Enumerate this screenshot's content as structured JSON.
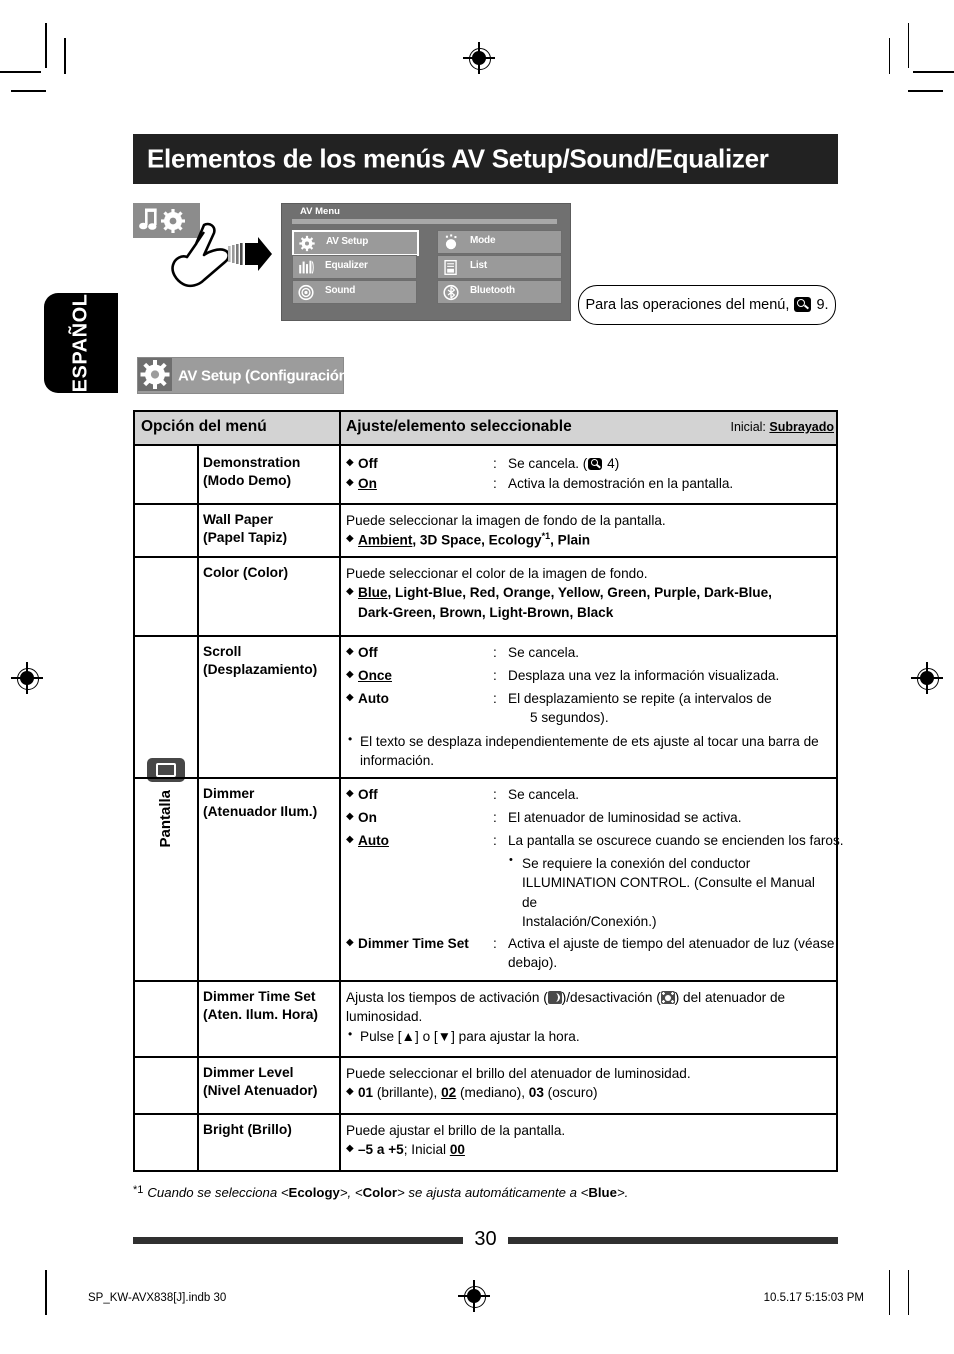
{
  "page": {
    "title": "Elementos de los menús AV Setup/Sound/Equalizer",
    "language_tab": "ESPAÑOL",
    "page_number": "30",
    "print_left": "SP_KW-AVX838[J].indb   30",
    "print_right": "10.5.17   5:15:03 PM"
  },
  "device_screen": {
    "header": "AV Menu",
    "buttons": [
      {
        "label": "AV Setup",
        "icon": "gear-icon",
        "selected": true
      },
      {
        "label": "Mode",
        "icon": "mode-icon",
        "selected": false
      },
      {
        "label": "Equalizer",
        "icon": "equalizer-icon",
        "selected": false
      },
      {
        "label": "List",
        "icon": "list-icon",
        "selected": false
      },
      {
        "label": "Sound",
        "icon": "sound-icon",
        "selected": false
      },
      {
        "label": "Bluetooth",
        "icon": "bluetooth-icon",
        "selected": false
      }
    ]
  },
  "callout": {
    "text_before": "Para las operaciones del menú,",
    "page_ref": "9."
  },
  "section": {
    "badge_label": "AV Setup (Configuración AV)",
    "side_tab_label": "Pantalla"
  },
  "table": {
    "header": {
      "col1": "Opción del menú",
      "col2": "Ajuste/elemento seleccionable",
      "initial_prefix": "Inicial:",
      "initial_value": "Subrayado"
    },
    "rows": {
      "demonstration": {
        "name_en": "Demonstration",
        "name_es": "(Modo Demo)",
        "options": [
          {
            "value": "Off",
            "underlined": false,
            "desc_before": "Se cancela. (",
            "ref": "4",
            "desc_after": ")"
          },
          {
            "value": "On",
            "underlined": true,
            "desc": "Activa la demostración en la pantalla."
          }
        ]
      },
      "wall_paper": {
        "name_en": "Wall Paper",
        "name_es": "(Papel Tapiz)",
        "intro": "Puede seleccionar la imagen de fondo de la pantalla.",
        "choices_default": "Ambient",
        "choices_rest": ", 3D Space, Ecology",
        "footnote_mark": "*1",
        "choices_tail": ", Plain"
      },
      "color": {
        "name_en": "Color (Color)",
        "intro": "Puede seleccionar el color de la imagen de fondo.",
        "choices_default": "Blue",
        "choices_line1": ", Light-Blue, Red, Orange, Yellow, Green, Purple, Dark-Blue,",
        "choices_line2": "Dark-Green, Brown, Light-Brown, Black"
      },
      "scroll": {
        "name_en": "Scroll",
        "name_es": "(Desplazamiento)",
        "options": [
          {
            "value": "Off",
            "underlined": false,
            "desc": "Se cancela."
          },
          {
            "value": "Once",
            "underlined": true,
            "desc": "Desplaza una vez la información visualizada."
          },
          {
            "value": "Auto",
            "underlined": false,
            "desc_l1": "El desplazamiento se repite (a intervalos de",
            "desc_l2": "5 segundos)."
          }
        ],
        "note_l1": "El texto se desplaza independientemente de ets ajuste al tocar una barra de",
        "note_l2": "información."
      },
      "dimmer": {
        "name_en": "Dimmer",
        "name_es": "(Atenuador Ilum.)",
        "options": [
          {
            "value": "Off",
            "underlined": false,
            "desc": "Se cancela."
          },
          {
            "value": "On",
            "underlined": false,
            "desc": "El atenuador de luminosidad se activa."
          },
          {
            "value": "Auto",
            "underlined": true,
            "desc": "La pantalla se oscurece cuando se encienden los faros."
          }
        ],
        "sub_notes": [
          "Se requiere la conexión del conductor",
          "ILLUMINATION CONTROL. (Consulte el Manual de",
          "Instalación/Conexión.)"
        ],
        "time_set_option": "Dimmer Time Set",
        "time_set_desc_l1": "Activa el ajuste de tiempo del atenuador de luz (véase",
        "time_set_desc_l2": "debajo)."
      },
      "dimmer_time_set": {
        "name_en": "Dimmer Time Set",
        "name_es": "(Aten. Ilum. Hora)",
        "desc_p1": "Ajusta los tiempos de activación (",
        "desc_p2": ")/desactivación (",
        "desc_p3": ") del atenuador de",
        "desc_l2": "luminosidad.",
        "note": "Pulse [▲] o [▼] para ajustar la hora."
      },
      "dimmer_level": {
        "name_en": "Dimmer Level",
        "name_es": "(Nivel Atenuador)",
        "intro": "Puede seleccionar el brillo del atenuador de luminosidad.",
        "c1_val": "01",
        "c1_note": " (brillante), ",
        "c2_val": "02",
        "c2_note": " (mediano), ",
        "c3_val": "03",
        "c3_note": " (oscuro)"
      },
      "bright": {
        "name_en": "Bright (Brillo)",
        "intro": "Puede ajustar el brillo de la pantalla.",
        "range": "–5 a +5",
        "initial_label": "; Inicial ",
        "initial_value": "00"
      }
    }
  },
  "footnote": {
    "mark": "*1",
    "p1": "Cuando se selecciona <",
    "b1": "Ecology",
    "p2": ">, <",
    "b2": "Color",
    "p3": "> se ajusta automáticamente a <",
    "b3": "Blue",
    "p4": ">."
  }
}
